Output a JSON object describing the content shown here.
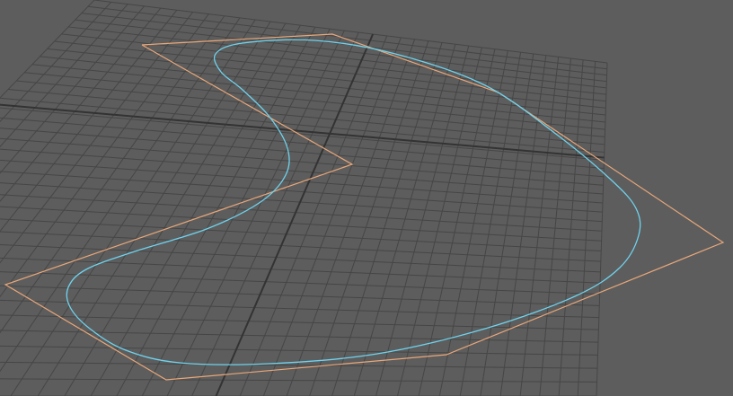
{
  "viewport": {
    "background_color": "#5d5d5d",
    "grid_color": "#464646",
    "axis_color": "#333333",
    "curve_color": "#6fd3ee",
    "control_polygon_color": "#e8a77a"
  }
}
